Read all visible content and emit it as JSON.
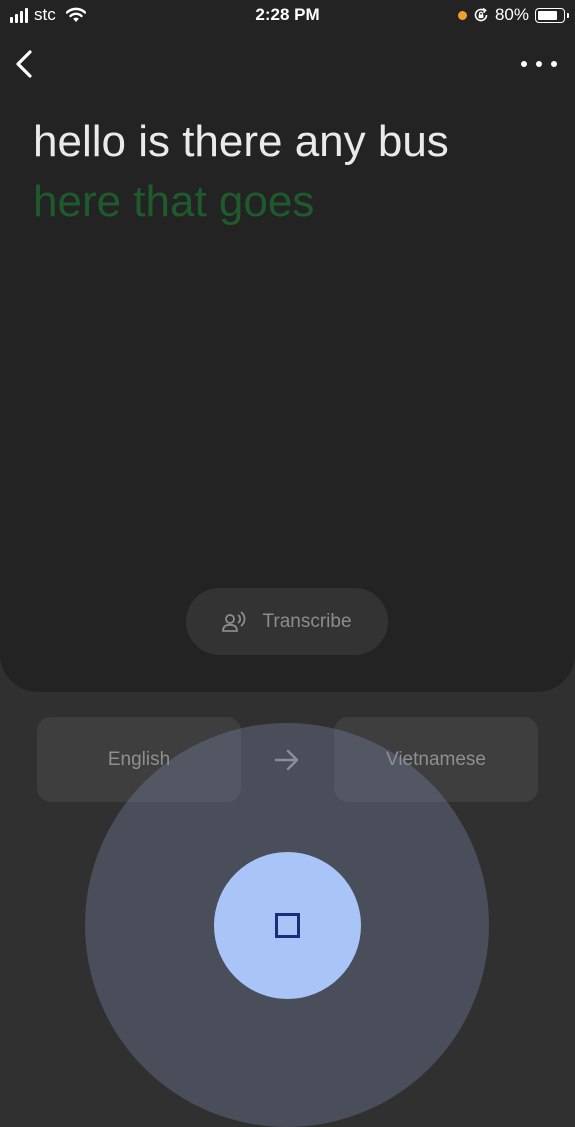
{
  "status_bar": {
    "carrier": "stc",
    "time": "2:28 PM",
    "battery": "80%"
  },
  "header": {
    "back_icon": "chevron-left-icon",
    "menu_icon": "more-horizontal-icon"
  },
  "transcript": {
    "final": "hello is there any bus",
    "interim": "here that goes"
  },
  "transcribe": {
    "label": "Transcribe",
    "icon": "voice-person-icon"
  },
  "languages": {
    "source": "English",
    "target": "Vietnamese",
    "swap_icon": "arrow-right-icon"
  },
  "mic": {
    "state_icon": "stop-icon"
  },
  "colors": {
    "background": "#303030",
    "panel": "#232323",
    "interim_text": "#1f5a2d",
    "mic_button": "#a9c5f7",
    "stop_icon": "#153078"
  }
}
